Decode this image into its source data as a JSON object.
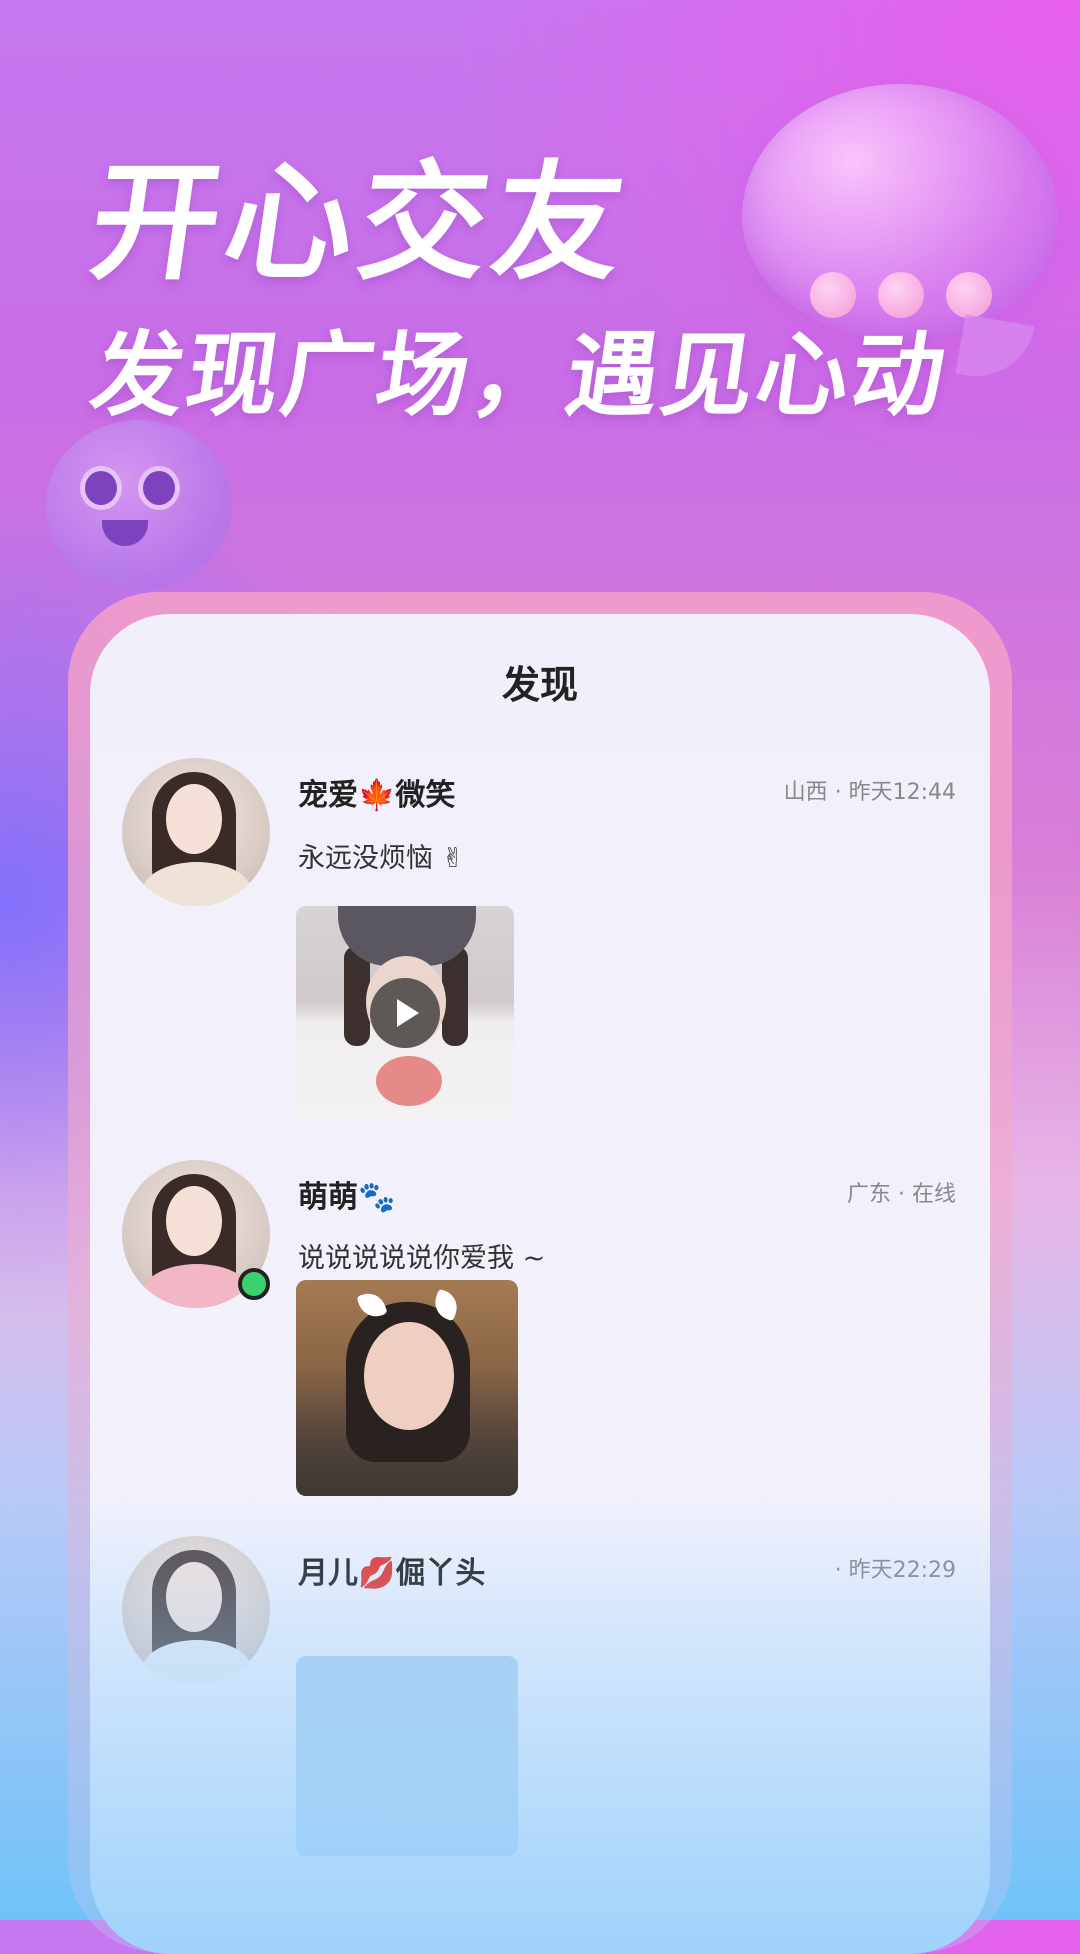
{
  "hero": {
    "headline": "开心交友",
    "subheadline": "发现广场，遇见心动"
  },
  "feed": {
    "title": "发现",
    "posts": [
      {
        "username": "宠爱🍁微笑",
        "meta": "山西 · 昨天12:44",
        "text": "永远没烦恼 ✌",
        "media": "video"
      },
      {
        "username": "萌萌🐾",
        "meta": "广东 · 在线",
        "text": "说说说说说你爱我 ~",
        "media": "photo",
        "online": true
      },
      {
        "username": "月儿💋倔丫头",
        "meta": "· 昨天22:29",
        "text": "",
        "media": "photo"
      }
    ]
  },
  "colors": {
    "accent_pink": "#e85fe0",
    "accent_purple": "#8a72ff",
    "accent_blue": "#6fc3f9",
    "online_green": "#3ad16e"
  },
  "icons": [
    "speech-bubble-icon",
    "mascot-face-icon",
    "play-icon"
  ]
}
